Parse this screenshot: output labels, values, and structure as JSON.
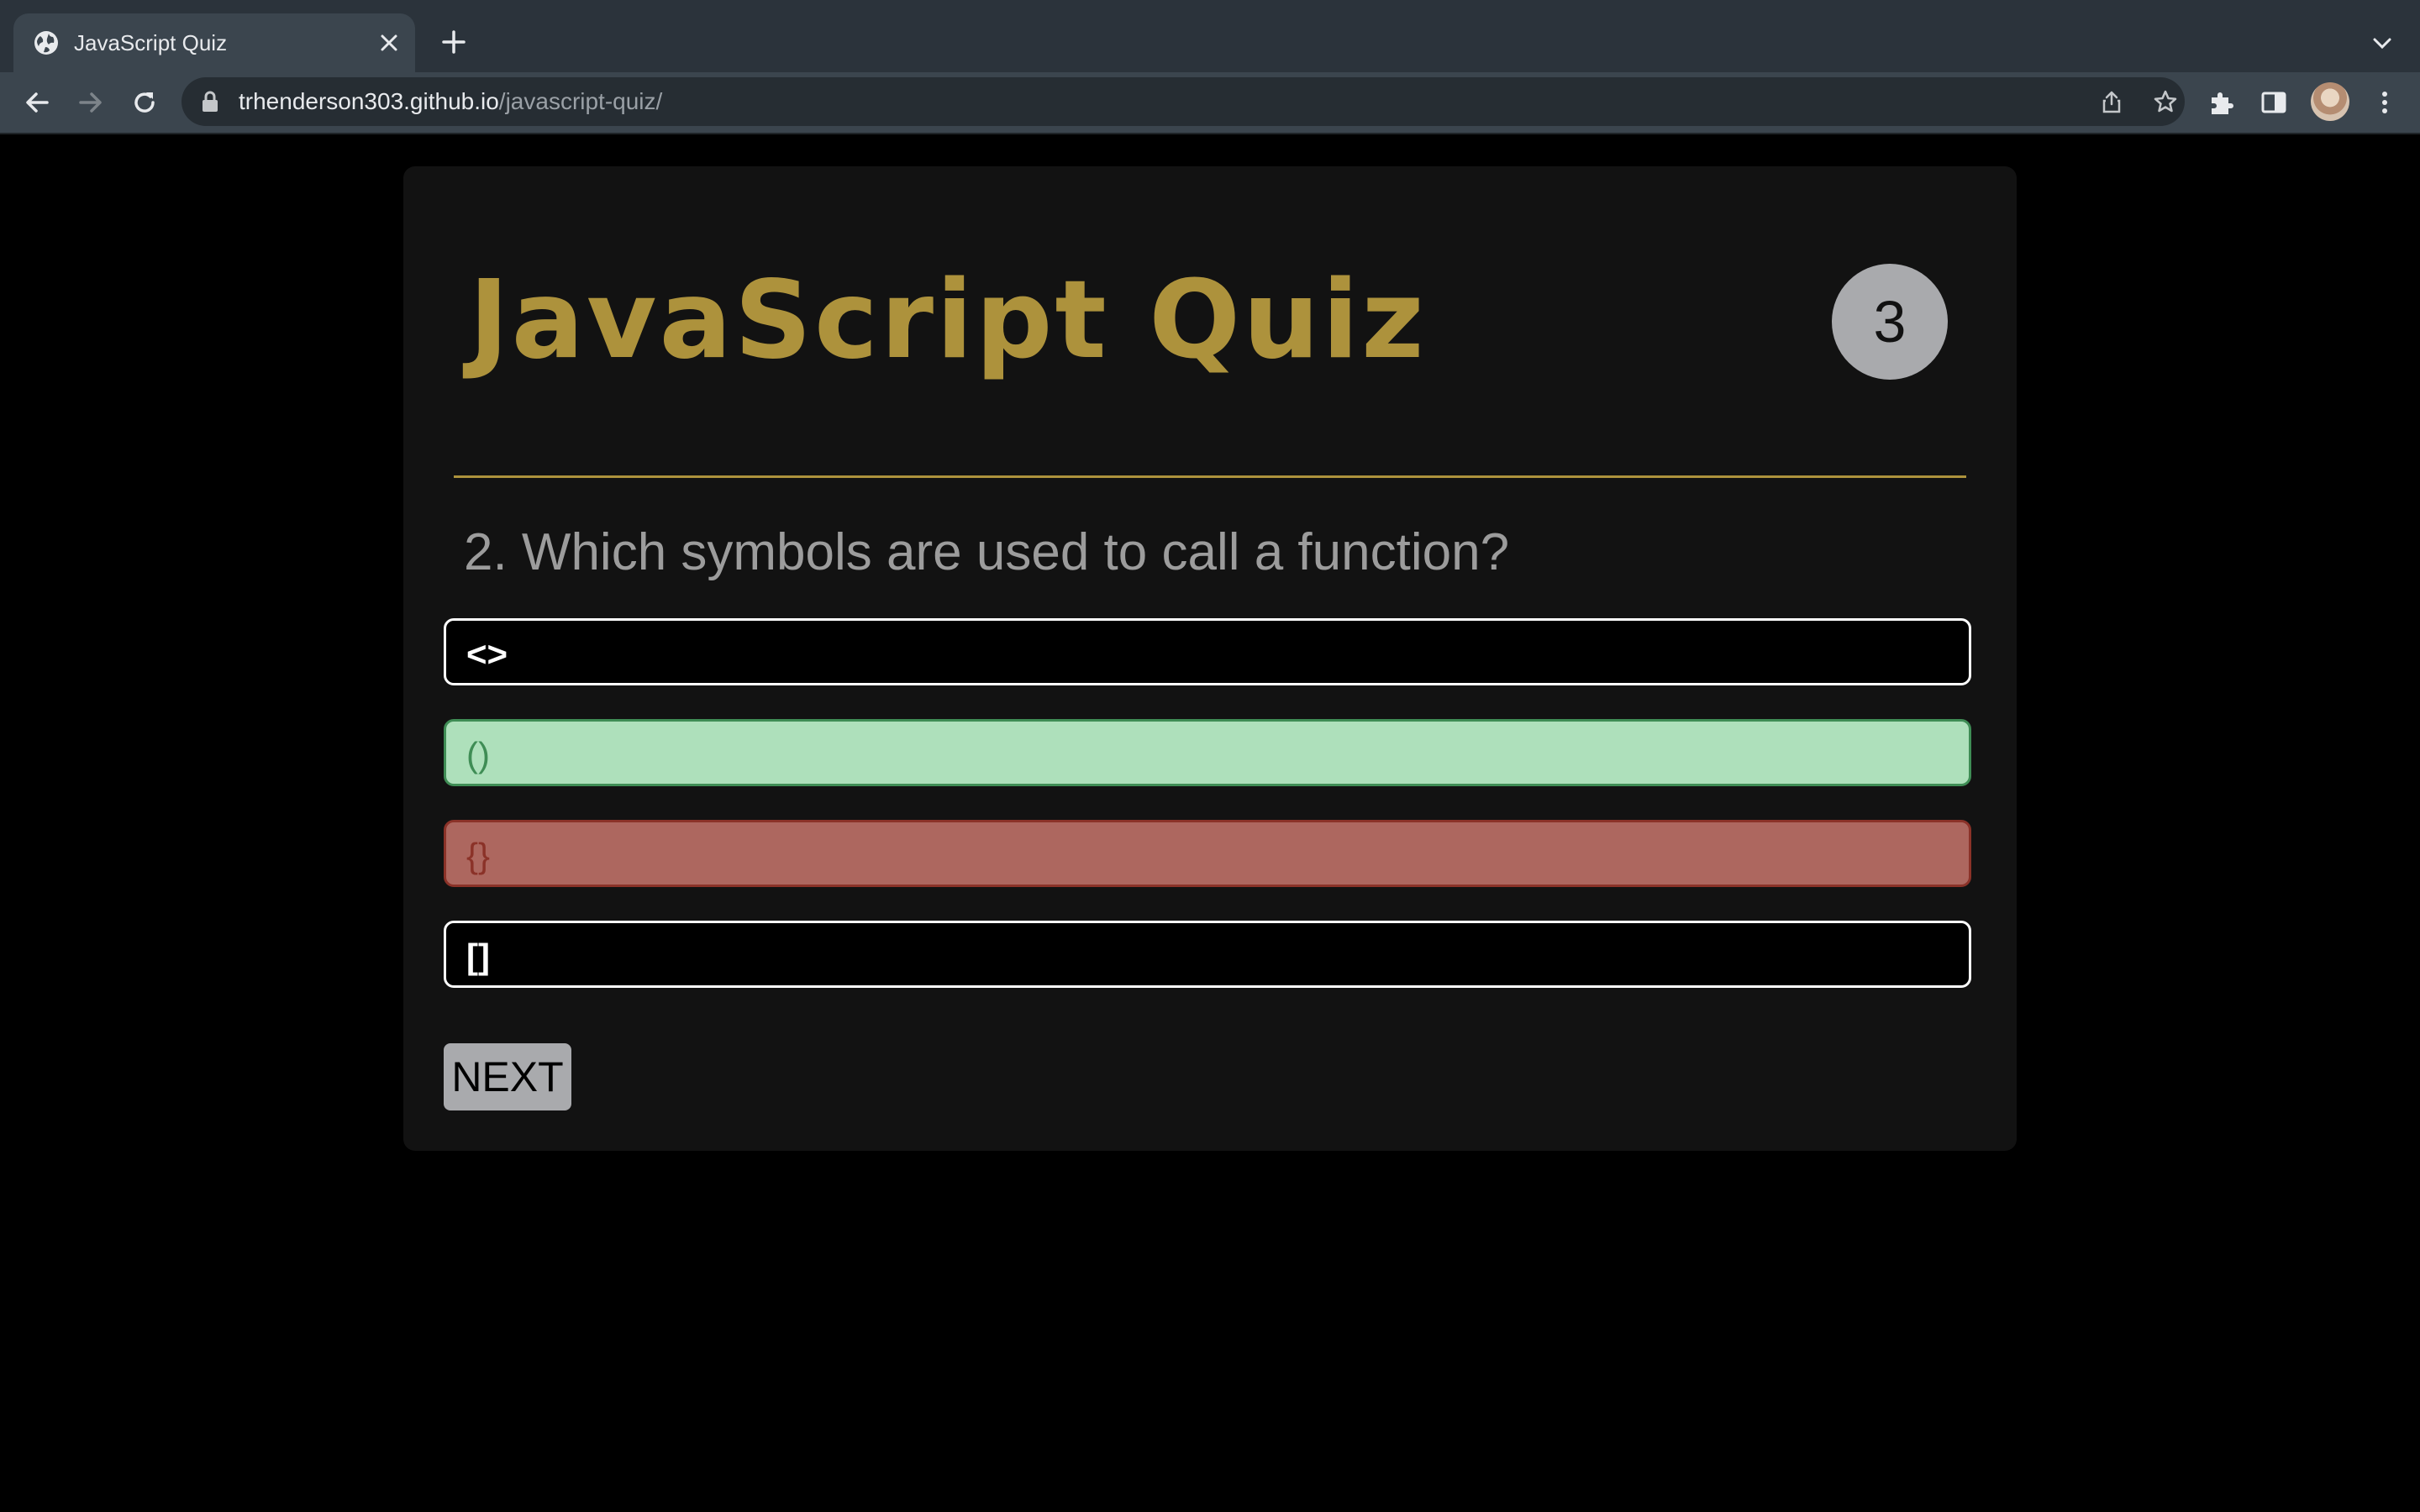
{
  "browser": {
    "tab_title": "JavaScript Quiz",
    "url_host": "trhenderson303.github.io",
    "url_path": "/javascript-quiz/"
  },
  "quiz": {
    "title": "JavaScript Quiz",
    "timer": "3",
    "question": "2. Which symbols are used to call a function?",
    "answers": [
      {
        "text": "<>",
        "state": "default"
      },
      {
        "text": "()",
        "state": "correct"
      },
      {
        "text": "{}",
        "state": "wrong"
      },
      {
        "text": "[]",
        "state": "default"
      }
    ],
    "next_label": "NEXT"
  },
  "colors": {
    "accent": "#ad923c",
    "correct_bg": "#aee0bb",
    "wrong_bg": "#ad675f",
    "timer_bg": "#a9aaad"
  }
}
